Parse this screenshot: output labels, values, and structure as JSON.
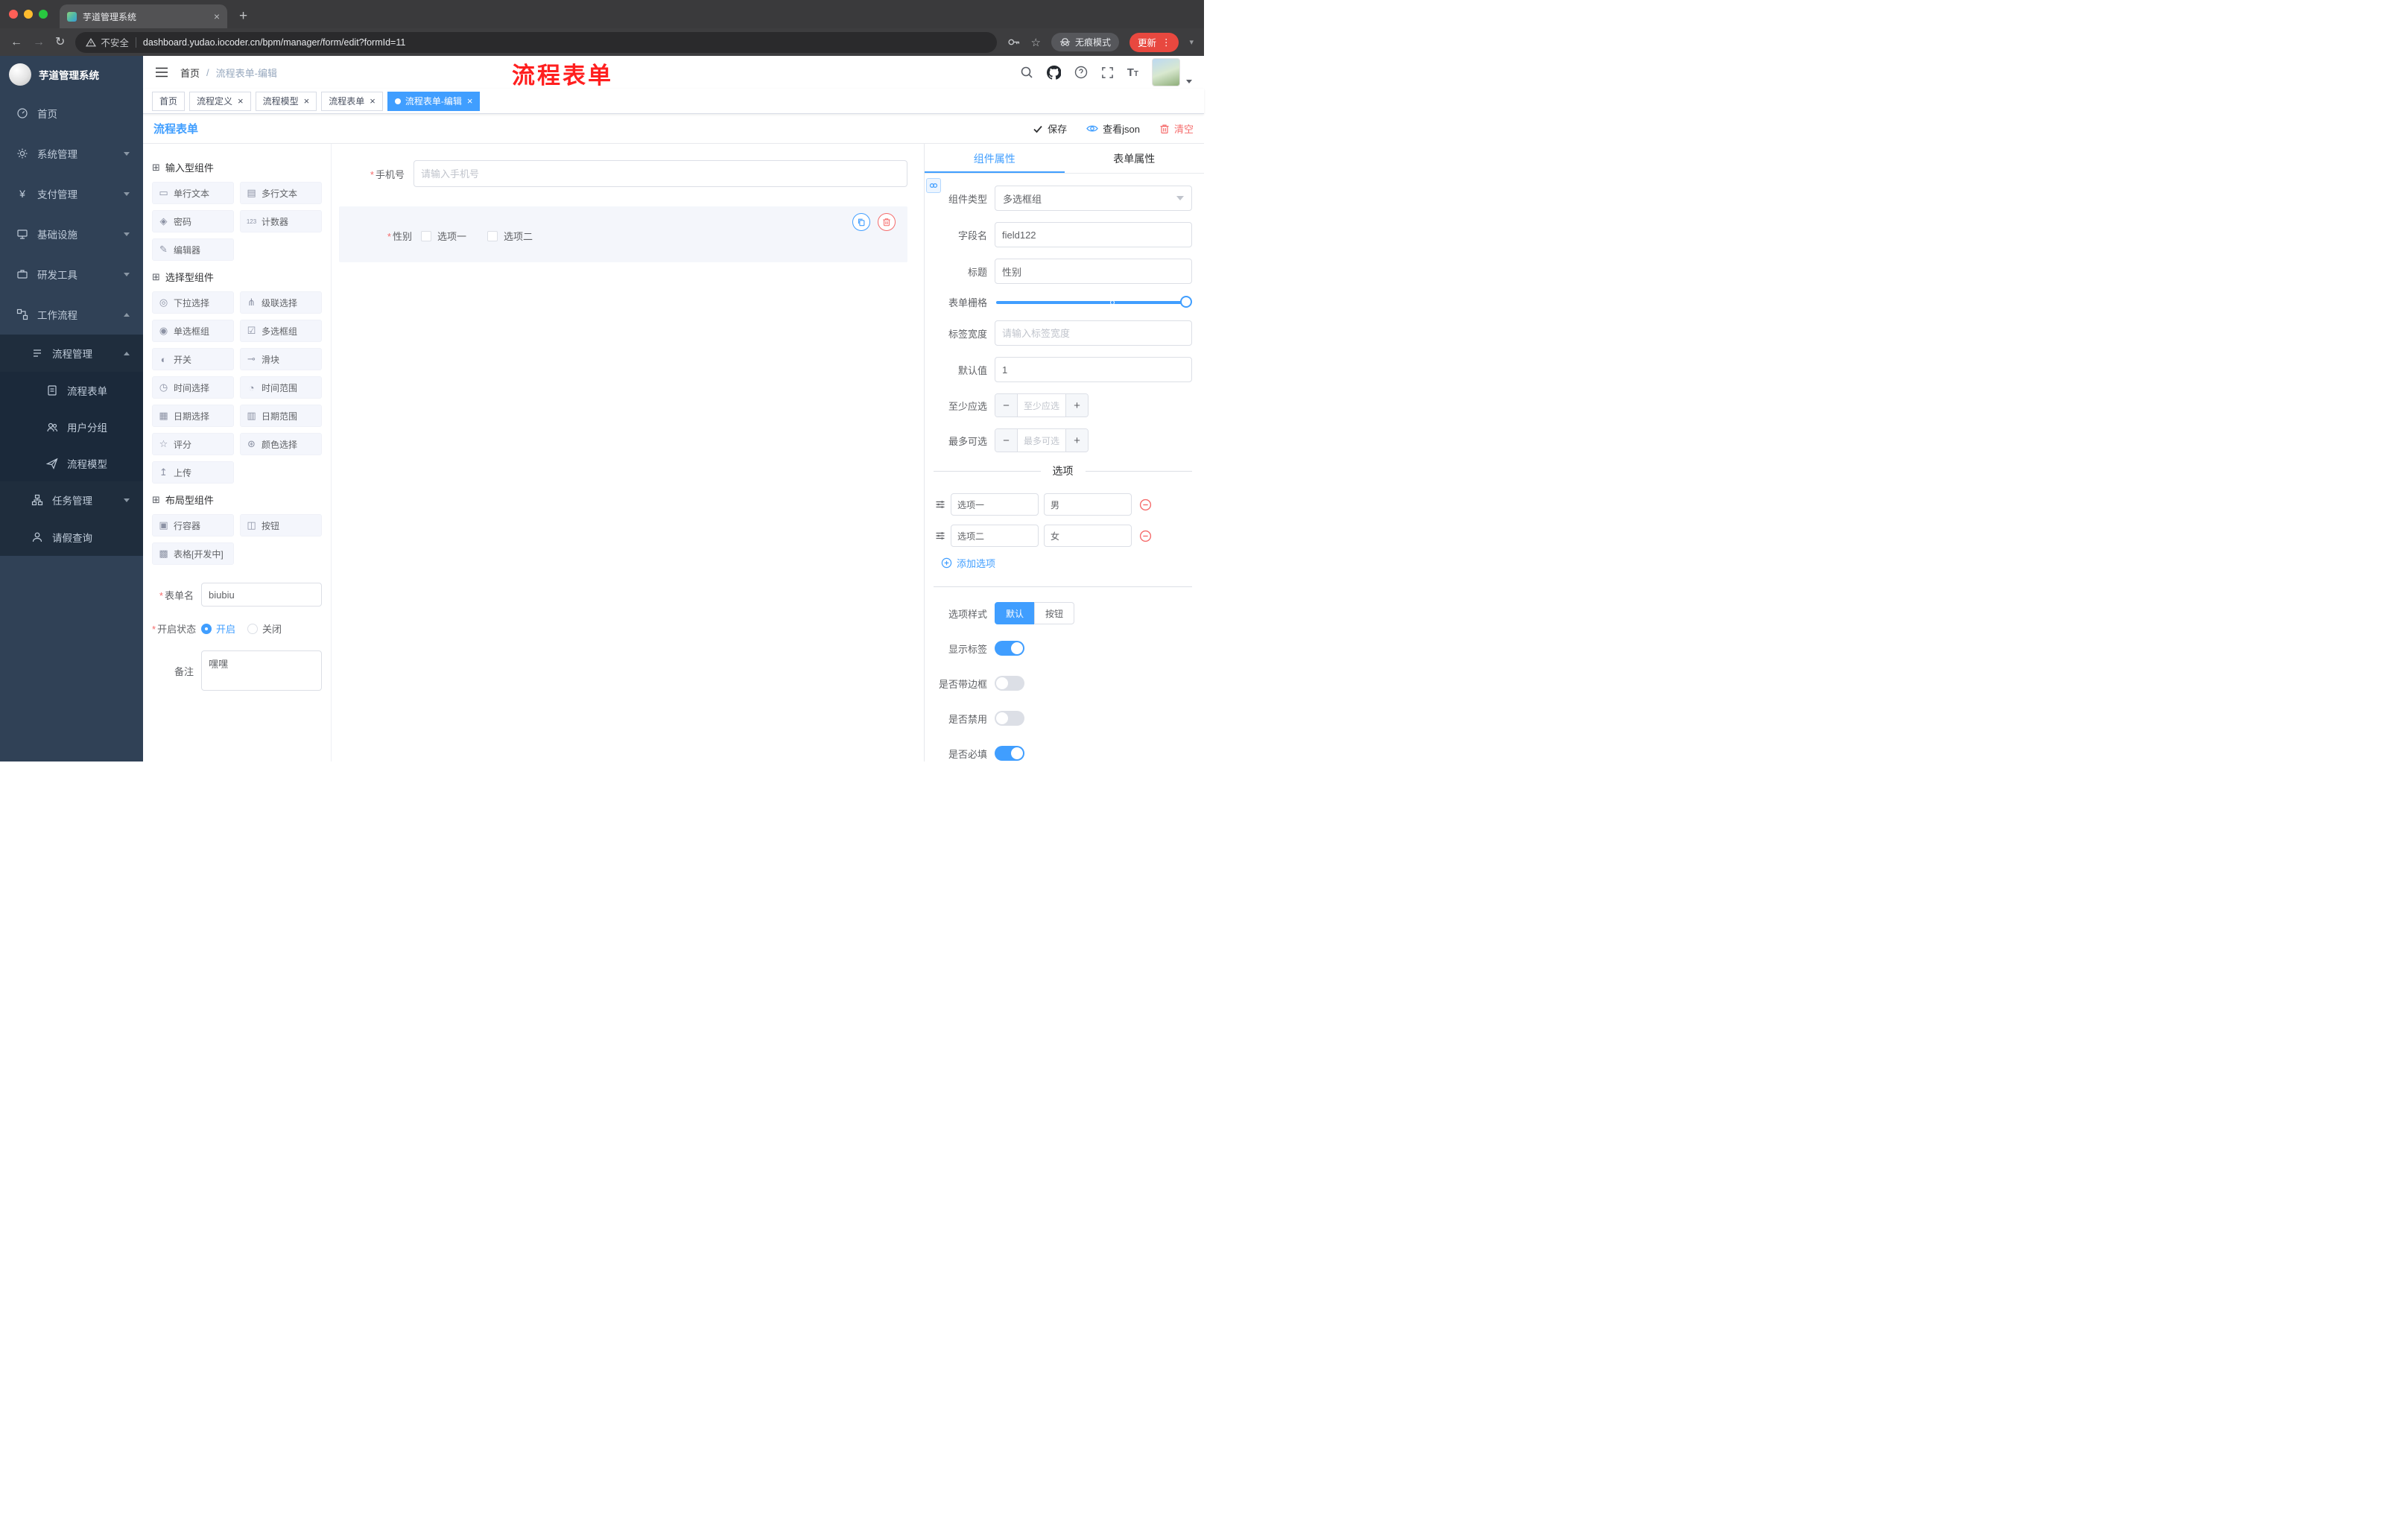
{
  "colors": {
    "accent": "#409eff",
    "danger": "#f56c6c",
    "sidebar_bg": "#304156",
    "submenu_bg": "#1f2d3d",
    "annotation": "#ff1f1f"
  },
  "browser": {
    "tab_title": "芋道管理系统",
    "security_label": "不安全",
    "url": "dashboard.yudao.iocoder.cn/bpm/manager/form/edit?formId=11",
    "incognito_label": "无痕模式",
    "update_label": "更新"
  },
  "header": {
    "breadcrumb_home": "首页",
    "breadcrumb_sep": "/",
    "breadcrumb_current": "流程表单-编辑",
    "annotation_title": "流程表单"
  },
  "sidebar": {
    "logo_title": "芋道管理系统",
    "items": [
      {
        "label": "首页",
        "icon": "dashboard-icon"
      },
      {
        "label": "系统管理",
        "icon": "gear-icon"
      },
      {
        "label": "支付管理",
        "icon": "payment-icon"
      },
      {
        "label": "基础设施",
        "icon": "infrastructure-icon"
      },
      {
        "label": "研发工具",
        "icon": "devtools-icon"
      },
      {
        "label": "工作流程",
        "icon": "workflow-icon"
      },
      {
        "label": "流程管理",
        "icon": "process-manage-icon"
      },
      {
        "label": "流程表单",
        "icon": "process-form-icon"
      },
      {
        "label": "用户分组",
        "icon": "user-group-icon"
      },
      {
        "label": "流程模型",
        "icon": "process-model-icon"
      },
      {
        "label": "任务管理",
        "icon": "task-manage-icon"
      },
      {
        "label": "请假查询",
        "icon": "leave-query-icon"
      }
    ]
  },
  "tags": [
    {
      "label": "首页",
      "closable": false,
      "active": false
    },
    {
      "label": "流程定义",
      "closable": true,
      "active": false
    },
    {
      "label": "流程模型",
      "closable": true,
      "active": false
    },
    {
      "label": "流程表单",
      "closable": true,
      "active": false
    },
    {
      "label": "流程表单-编辑",
      "closable": true,
      "active": true
    }
  ],
  "designer": {
    "panel_title": "流程表单",
    "toolbar": {
      "save": "保存",
      "view_json": "查看json",
      "clear": "清空"
    },
    "palette": {
      "sections": [
        {
          "title": "输入型组件",
          "icon": "component-box-icon",
          "glyph": "⊞",
          "items": [
            {
              "label": "单行文本",
              "icon": "single-line-text-icon",
              "glyph": "▭"
            },
            {
              "label": "多行文本",
              "icon": "multi-line-text-icon",
              "glyph": "▤"
            },
            {
              "label": "密码",
              "icon": "password-lock-icon",
              "glyph": "◈"
            },
            {
              "label": "计数器",
              "icon": "counter-icon",
              "glyph": "123"
            },
            {
              "label": "编辑器",
              "icon": "editor-icon",
              "glyph": "✎"
            }
          ]
        },
        {
          "title": "选择型组件",
          "icon": "component-box-icon",
          "glyph": "⊞",
          "items": [
            {
              "label": "下拉选择",
              "icon": "select-icon",
              "glyph": "◎"
            },
            {
              "label": "级联选择",
              "icon": "cascader-icon",
              "glyph": "⋔"
            },
            {
              "label": "单选框组",
              "icon": "radio-group-icon",
              "glyph": "◉"
            },
            {
              "label": "多选框组",
              "icon": "checkbox-group-icon",
              "glyph": "☑"
            },
            {
              "label": "开关",
              "icon": "switch-icon",
              "glyph": "◐"
            },
            {
              "label": "滑块",
              "icon": "slider-icon",
              "glyph": "⊸"
            },
            {
              "label": "时间选择",
              "icon": "time-picker-icon",
              "glyph": "◷"
            },
            {
              "label": "时间范围",
              "icon": "time-range-icon",
              "glyph": "◔"
            },
            {
              "label": "日期选择",
              "icon": "date-picker-icon",
              "glyph": "▦"
            },
            {
              "label": "日期范围",
              "icon": "date-range-icon",
              "glyph": "▥"
            },
            {
              "label": "评分",
              "icon": "rate-star-icon",
              "glyph": "☆"
            },
            {
              "label": "颜色选择",
              "icon": "color-picker-icon",
              "glyph": "⊛"
            },
            {
              "label": "上传",
              "icon": "upload-icon",
              "glyph": "↥"
            }
          ]
        },
        {
          "title": "布局型组件",
          "icon": "component-box-icon",
          "glyph": "⊞",
          "items": [
            {
              "label": "行容器",
              "icon": "row-container-icon",
              "glyph": "▣"
            },
            {
              "label": "按钮",
              "icon": "button-icon",
              "glyph": "◫"
            },
            {
              "label": "表格[开发中]",
              "icon": "table-icon",
              "glyph": "▩"
            }
          ]
        }
      ]
    },
    "meta": {
      "form_name_label": "表单名",
      "form_name_value": "biubiu",
      "status_label": "开启状态",
      "status_on": "开启",
      "status_off": "关闭",
      "remark_label": "备注",
      "remark_value": "嘿嘿"
    },
    "canvas": {
      "phone_label": "手机号",
      "phone_placeholder": "请输入手机号",
      "gender_label": "性别",
      "gender_option1": "选项一",
      "gender_option2": "选项二"
    }
  },
  "props": {
    "tab_component": "组件属性",
    "tab_form": "表单属性",
    "component_type_label": "组件类型",
    "component_type_value": "多选框组",
    "field_name_label": "字段名",
    "field_name_value": "field122",
    "title_label": "标题",
    "title_value": "性别",
    "grid_label": "表单栅格",
    "label_width_label": "标签宽度",
    "label_width_placeholder": "请输入标签宽度",
    "default_label": "默认值",
    "default_value": "1",
    "min_label": "至少应选",
    "min_placeholder": "至少应选",
    "max_label": "最多可选",
    "max_placeholder": "最多可选",
    "options_title": "选项",
    "options": [
      {
        "label": "选项一",
        "value": "男"
      },
      {
        "label": "选项二",
        "value": "女"
      }
    ],
    "add_option": "添加选项",
    "style_label": "选项样式",
    "style_default": "默认",
    "style_button": "按钮",
    "switch_show_label": "显示标签",
    "switch_border": "是否带边框",
    "switch_disabled": "是否禁用",
    "switch_required": "是否必填"
  }
}
